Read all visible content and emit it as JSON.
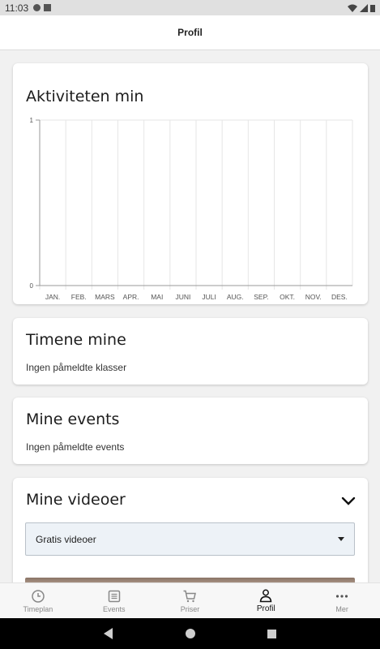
{
  "status_bar": {
    "time": "11:03"
  },
  "app_bar": {
    "title": "Profil"
  },
  "activity_card": {
    "title": "Aktiviteten min"
  },
  "chart_data": {
    "type": "line",
    "categories": [
      "JAN.",
      "FEB.",
      "MARS",
      "APR.",
      "MAI",
      "JUNI",
      "JULI",
      "AUG.",
      "SEP.",
      "OKT.",
      "NOV.",
      "DES."
    ],
    "values": [],
    "ylim": [
      0,
      1
    ],
    "yticks": [
      "0",
      "1"
    ],
    "grid": true,
    "title": "",
    "xlabel": "",
    "ylabel": ""
  },
  "classes_card": {
    "title": "Timene mine",
    "empty_text": "Ingen påmeldte klasser"
  },
  "events_card": {
    "title": "Mine events",
    "empty_text": "Ingen påmeldte events"
  },
  "videos_card": {
    "title": "Mine videoer",
    "select_value": "Gratis videoer"
  },
  "bottom_nav": {
    "items": [
      {
        "label": "Timeplan",
        "icon": "clock-icon"
      },
      {
        "label": "Events",
        "icon": "list-icon"
      },
      {
        "label": "Priser",
        "icon": "cart-icon"
      },
      {
        "label": "Profil",
        "icon": "person-icon"
      },
      {
        "label": "Mer",
        "icon": "more-icon"
      }
    ],
    "active_index": 3
  }
}
